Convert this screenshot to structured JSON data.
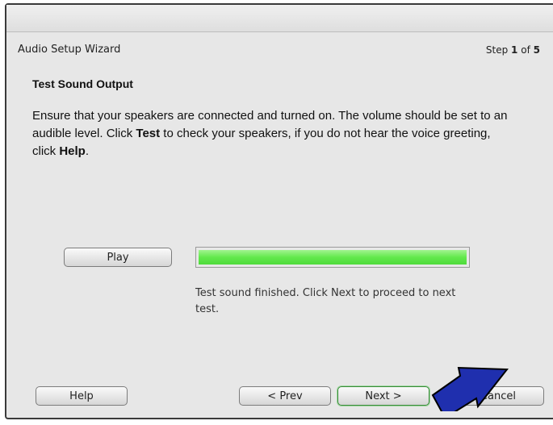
{
  "wizard": {
    "title": "Audio Setup Wizard",
    "step_prefix": "Step",
    "step_current": "1",
    "step_of": "of",
    "step_total": "5"
  },
  "content": {
    "heading": "Test Sound Output",
    "text_1": "Ensure that your speakers are connected and turned on. The volume should be set to an audible level. Click ",
    "text_bold_1": "Test",
    "text_2": " to check your speakers, if you do not hear the voice greeting, click ",
    "text_bold_2": "Help",
    "text_3": "."
  },
  "test": {
    "play_label": "Play",
    "progress_fraction": 1.0,
    "progress_color": "#5ee64a",
    "status": "Test sound finished. Click Next to proceed to next test."
  },
  "footer": {
    "help_label": "Help",
    "prev_label": "< Prev",
    "next_label": "Next >",
    "cancel_label": "Cancel"
  },
  "annotation": {
    "arrow_color": "#1f2fae",
    "arrow_icon": "arrow-pointer-icon"
  }
}
